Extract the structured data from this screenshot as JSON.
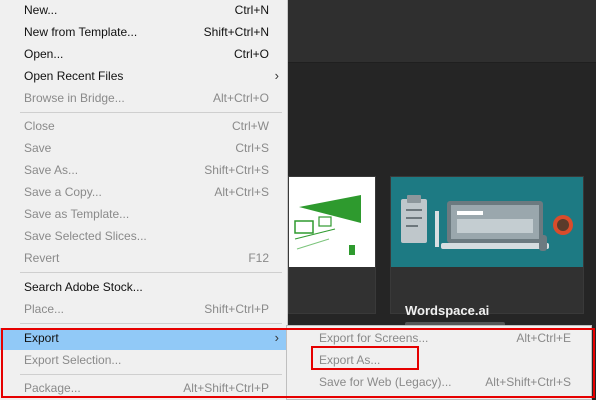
{
  "menu": {
    "items": [
      {
        "label": "New...",
        "shortcut": "Ctrl+N",
        "disabled": false
      },
      {
        "label": "New from Template...",
        "shortcut": "Shift+Ctrl+N",
        "disabled": false
      },
      {
        "label": "Open...",
        "shortcut": "Ctrl+O",
        "disabled": false
      },
      {
        "label": "Open Recent Files",
        "shortcut": "",
        "disabled": false,
        "has_submenu": true
      },
      {
        "label": "Browse in Bridge...",
        "shortcut": "Alt+Ctrl+O",
        "disabled": true
      },
      {
        "label": "Close",
        "shortcut": "Ctrl+W",
        "disabled": true
      },
      {
        "label": "Save",
        "shortcut": "Ctrl+S",
        "disabled": true
      },
      {
        "label": "Save As...",
        "shortcut": "Shift+Ctrl+S",
        "disabled": true
      },
      {
        "label": "Save a Copy...",
        "shortcut": "Alt+Ctrl+S",
        "disabled": true
      },
      {
        "label": "Save as Template...",
        "shortcut": "",
        "disabled": true
      },
      {
        "label": "Save Selected Slices...",
        "shortcut": "",
        "disabled": true
      },
      {
        "label": "Revert",
        "shortcut": "F12",
        "disabled": true
      },
      {
        "label": "Search Adobe Stock...",
        "shortcut": "",
        "disabled": false
      },
      {
        "label": "Place...",
        "shortcut": "Shift+Ctrl+P",
        "disabled": true
      },
      {
        "label": "Export",
        "shortcut": "",
        "disabled": false,
        "has_submenu": true,
        "highlighted": true
      },
      {
        "label": "Export Selection...",
        "shortcut": "",
        "disabled": true
      },
      {
        "label": "Package...",
        "shortcut": "Alt+Shift+Ctrl+P",
        "disabled": true
      }
    ],
    "submenu_arrow": "›"
  },
  "export_submenu": {
    "items": [
      {
        "label": "Export for Screens...",
        "shortcut": "Alt+Ctrl+E",
        "disabled": true
      },
      {
        "label": "Export As...",
        "shortcut": "",
        "disabled": true
      },
      {
        "label": "Save for Web (Legacy)...",
        "shortcut": "Alt+Shift+Ctrl+S",
        "disabled": true
      }
    ]
  },
  "recent": {
    "cards": [
      {
        "title": ""
      },
      {
        "title": "Wordspace.ai"
      }
    ]
  },
  "colors": {
    "highlight": "#91c9f7",
    "annotation": "#e60000",
    "thumbnail_teal": "#1d7a83"
  }
}
